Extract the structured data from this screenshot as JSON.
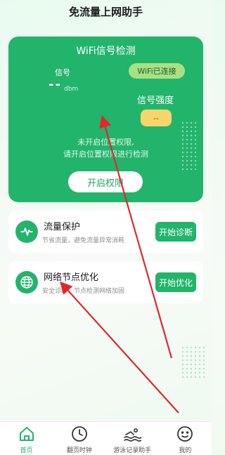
{
  "header": {
    "title": "免流量上网助手"
  },
  "signal_card": {
    "title": "WiFi信号检测",
    "signal_label": "信号",
    "signal_value": "--",
    "signal_unit": "dbm",
    "wifi_status": "WiFi已连接",
    "strength_label": "信号强度",
    "strength_value": "--",
    "notice_line1": "未开启位置权限,",
    "notice_line2": "请开启位置权限进行检测",
    "button_label": "开启权限"
  },
  "features": [
    {
      "title": "流量保护",
      "desc": "节省流量，避免流量异常消耗",
      "button": "开始诊断",
      "icon": "pulse-icon"
    },
    {
      "title": "网络节点优化",
      "desc": "安全诊断，节点检测网络加固",
      "button": "开始优化",
      "icon": "globe-icon"
    }
  ],
  "nav": {
    "items": [
      {
        "label": "首页",
        "icon": "home-icon"
      },
      {
        "label": "翻页时钟",
        "icon": "clock-icon"
      },
      {
        "label": "游泳记录助手",
        "icon": "swimmer-icon"
      },
      {
        "label": "我的",
        "icon": "face-icon"
      }
    ]
  },
  "colors": {
    "accent": "#22b46b",
    "badge": "#a7e184",
    "strength": "#f6d56a",
    "arrow": "#e0282e"
  }
}
